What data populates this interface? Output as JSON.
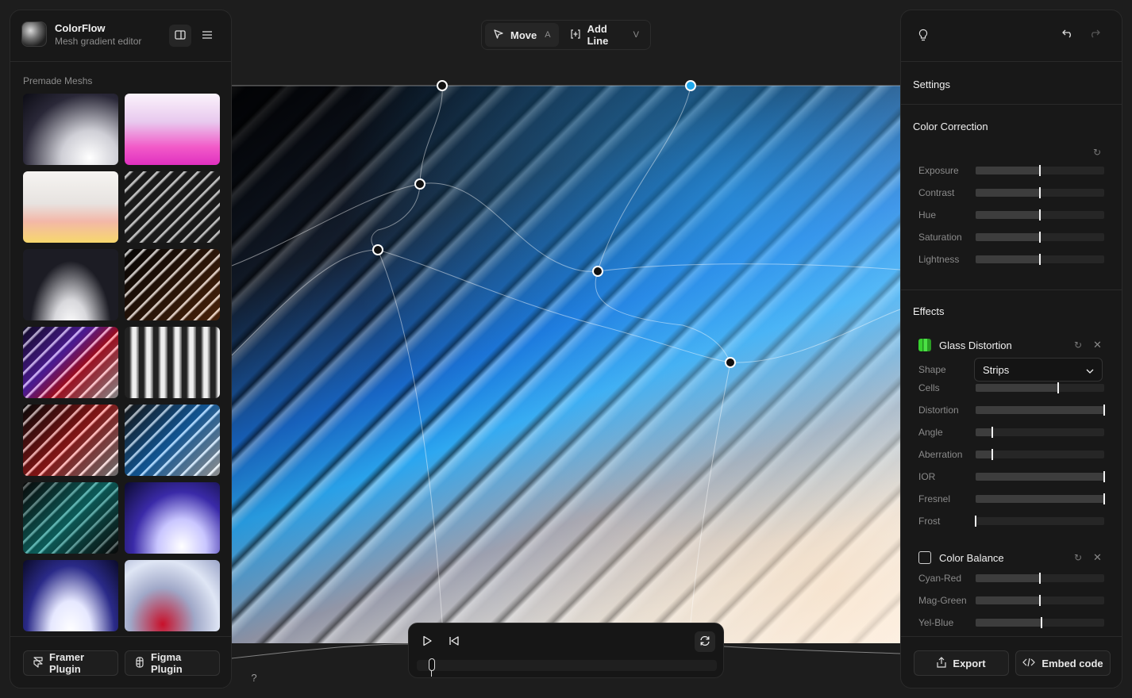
{
  "app": {
    "name": "ColorFlow",
    "subtitle": "Mesh gradient editor"
  },
  "left_panel": {
    "section_label": "Premade Meshs",
    "thumbnail_count": 14,
    "framer_plugin": "Framer Plugin",
    "figma_plugin": "Figma Plugin",
    "help": "?"
  },
  "toolbar": {
    "move": {
      "label": "Move",
      "shortcut": "A"
    },
    "add_line": {
      "label": "Add Line",
      "shortcut": "V"
    }
  },
  "right_panel": {
    "settings_title": "Settings",
    "color_correction": {
      "title": "Color Correction",
      "sliders": [
        {
          "label": "Exposure",
          "value": 0.5
        },
        {
          "label": "Contrast",
          "value": 0.5
        },
        {
          "label": "Hue",
          "value": 0.5
        },
        {
          "label": "Saturation",
          "value": 0.5
        },
        {
          "label": "Lightness",
          "value": 0.5
        }
      ]
    },
    "effects_title": "Effects",
    "glass_distortion": {
      "title": "Glass Distortion",
      "enabled": true,
      "shape_label": "Shape",
      "shape_value": "Strips",
      "sliders": [
        {
          "label": "Cells",
          "value": 0.64
        },
        {
          "label": "Distortion",
          "value": 1.0
        },
        {
          "label": "Angle",
          "value": 0.13
        },
        {
          "label": "Aberration",
          "value": 0.13
        },
        {
          "label": "IOR",
          "value": 1.0
        },
        {
          "label": "Fresnel",
          "value": 1.0
        },
        {
          "label": "Frost",
          "value": 0.0
        }
      ]
    },
    "color_balance": {
      "title": "Color Balance",
      "enabled": false,
      "sliders": [
        {
          "label": "Cyan-Red",
          "value": 0.5
        },
        {
          "label": "Mag-Green",
          "value": 0.5
        },
        {
          "label": "Yel-Blue",
          "value": 0.51
        }
      ]
    },
    "export": "Export",
    "embed_code": "Embed code"
  },
  "playback": {
    "progress": 0.04
  },
  "colors": {
    "accent": "#1fa8ee",
    "panel_bg": "#181818",
    "app_bg": "#1d1d1d",
    "glass_icon": "#38d130"
  }
}
